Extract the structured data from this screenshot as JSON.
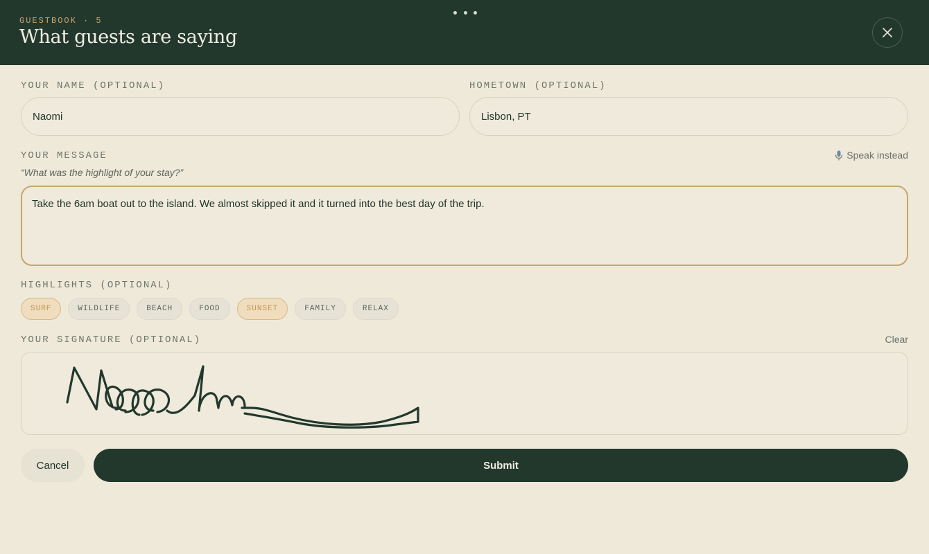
{
  "header": {
    "eyebrow": "GUESTBOOK · 5",
    "title": "What guests are saying",
    "close_icon": "close-icon",
    "drag_icon": "drag-handle-icon"
  },
  "form": {
    "name": {
      "label": "YOUR NAME (OPTIONAL)",
      "value": "Naomi"
    },
    "hometown": {
      "label": "HOMETOWN (OPTIONAL)",
      "value": "Lisbon, PT"
    },
    "message": {
      "label": "YOUR MESSAGE",
      "speak_label": "Speak instead",
      "speak_icon": "microphone-icon",
      "prompt": "“What was the highlight of your stay?”",
      "value": "Take the 6am boat out to the island. We almost skipped it and it turned into the best day of the trip."
    },
    "highlights": {
      "label": "HIGHLIGHTS (OPTIONAL)",
      "chips": [
        {
          "label": "SURF",
          "selected": true
        },
        {
          "label": "WILDLIFE",
          "selected": false
        },
        {
          "label": "BEACH",
          "selected": false
        },
        {
          "label": "FOOD",
          "selected": false
        },
        {
          "label": "SUNSET",
          "selected": true
        },
        {
          "label": "FAMILY",
          "selected": false
        },
        {
          "label": "RELAX",
          "selected": false
        }
      ]
    },
    "signature": {
      "label": "YOUR SIGNATURE (OPTIONAL)",
      "clear_label": "Clear"
    }
  },
  "actions": {
    "cancel_label": "Cancel",
    "submit_label": "Submit"
  },
  "colors": {
    "header_bg": "#22382d",
    "page_bg": "#efe9da",
    "accent": "#c8a56b",
    "chip_selected_bg": "#efddbd",
    "ink": "#1f3329"
  }
}
